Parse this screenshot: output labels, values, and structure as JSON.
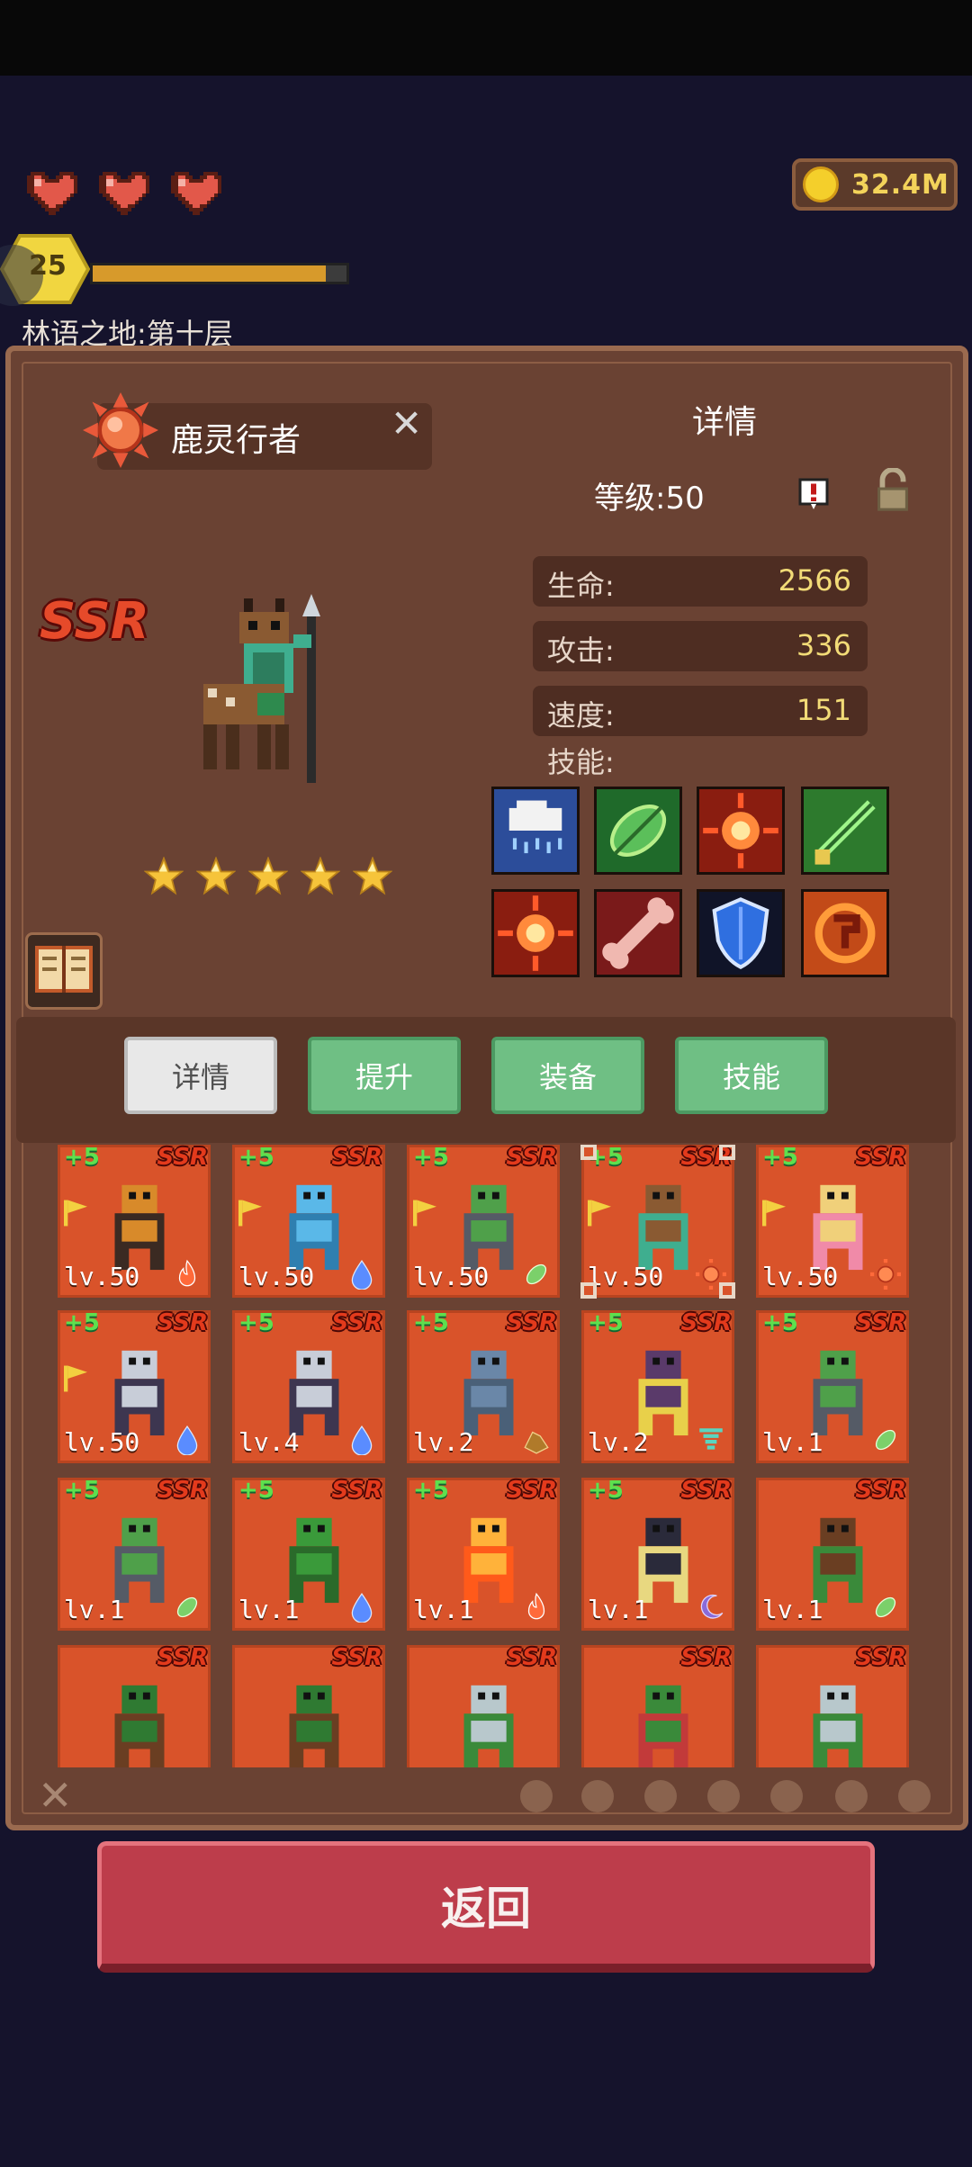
{
  "hud": {
    "gold": "32.4M",
    "player_level": "25",
    "xp_progress": 0.92,
    "location": "林语之地:第十层",
    "hearts": 3
  },
  "hero": {
    "name": "鹿灵行者",
    "rarity": "SSR",
    "stars": 5
  },
  "detail": {
    "title": "详情",
    "level_label": "等级:50",
    "stats": [
      {
        "label": "生命:",
        "value": "2566"
      },
      {
        "label": "攻击:",
        "value": "336"
      },
      {
        "label": "速度:",
        "value": "151"
      }
    ],
    "skills_label": "技能:",
    "skills": [
      {
        "icon": "rain-cloud-icon",
        "color": "#2c4d9a"
      },
      {
        "icon": "leaf-icon",
        "color": "#1f6a2a"
      },
      {
        "icon": "fire-burst-icon",
        "color": "#8a1d10"
      },
      {
        "icon": "green-sword-icon",
        "color": "#2d7a2d"
      },
      {
        "icon": "fire-burst-icon",
        "color": "#8a1d10"
      },
      {
        "icon": "bone-icon",
        "color": "#7a1a1a"
      },
      {
        "icon": "blue-shield-icon",
        "color": "#101428"
      },
      {
        "icon": "fire-circle-icon",
        "color": "#c24a18"
      }
    ]
  },
  "tabs": [
    {
      "label": "详情",
      "active": true
    },
    {
      "label": "提升",
      "active": false
    },
    {
      "label": "装备",
      "active": false
    },
    {
      "label": "技能",
      "active": false
    }
  ],
  "roster": [
    {
      "plus": "+5",
      "rarity": "SSR",
      "level": "lv.50",
      "flag": true,
      "element": "fire",
      "monster": "fire-warrior",
      "selected": false
    },
    {
      "plus": "+5",
      "rarity": "SSR",
      "level": "lv.50",
      "flag": true,
      "element": "water",
      "monster": "water-spirit",
      "selected": false
    },
    {
      "plus": "+5",
      "rarity": "SSR",
      "level": "lv.50",
      "flag": true,
      "element": "nature",
      "monster": "orc-rider",
      "selected": false
    },
    {
      "plus": "+5",
      "rarity": "SSR",
      "level": "lv.50",
      "flag": true,
      "element": "light",
      "monster": "deer-walker",
      "selected": true
    },
    {
      "plus": "+5",
      "rarity": "SSR",
      "level": "lv.50",
      "flag": true,
      "element": "light",
      "monster": "fairy",
      "selected": false
    },
    {
      "plus": "+5",
      "rarity": "SSR",
      "level": "lv.50",
      "flag": true,
      "element": "water",
      "monster": "ghost-knight",
      "selected": false
    },
    {
      "plus": "+5",
      "rarity": "SSR",
      "level": "lv.4",
      "flag": false,
      "element": "water",
      "monster": "ghost-knight",
      "selected": false
    },
    {
      "plus": "+5",
      "rarity": "SSR",
      "level": "lv.2",
      "flag": false,
      "element": "earth",
      "monster": "stone-golem",
      "selected": false
    },
    {
      "plus": "+5",
      "rarity": "SSR",
      "level": "lv.2",
      "flag": false,
      "element": "wind",
      "monster": "reaper",
      "selected": false
    },
    {
      "plus": "+5",
      "rarity": "SSR",
      "level": "lv.1",
      "flag": false,
      "element": "nature",
      "monster": "orc-rider",
      "selected": false
    },
    {
      "plus": "+5",
      "rarity": "SSR",
      "level": "lv.1",
      "flag": false,
      "element": "nature",
      "monster": "orc-rider",
      "selected": false
    },
    {
      "plus": "+5",
      "rarity": "SSR",
      "level": "lv.1",
      "flag": false,
      "element": "water",
      "monster": "swamp-ogre",
      "selected": false
    },
    {
      "plus": "+5",
      "rarity": "SSR",
      "level": "lv.1",
      "flag": false,
      "element": "fire",
      "monster": "flame-sprite",
      "selected": false
    },
    {
      "plus": "+5",
      "rarity": "SSR",
      "level": "lv.1",
      "flag": false,
      "element": "dark",
      "monster": "dark-knight",
      "selected": false
    },
    {
      "plus": "",
      "rarity": "SSR",
      "level": "lv.1",
      "flag": false,
      "element": "nature",
      "monster": "treant",
      "selected": false
    },
    {
      "plus": "",
      "rarity": "SSR",
      "level": "",
      "flag": false,
      "element": "",
      "monster": "tree-beast",
      "selected": false
    },
    {
      "plus": "",
      "rarity": "SSR",
      "level": "",
      "flag": false,
      "element": "",
      "monster": "tree-beast",
      "selected": false
    },
    {
      "plus": "",
      "rarity": "SSR",
      "level": "",
      "flag": false,
      "element": "",
      "monster": "wolf-warrior",
      "selected": false
    },
    {
      "plus": "",
      "rarity": "SSR",
      "level": "",
      "flag": false,
      "element": "",
      "monster": "orc-blade",
      "selected": false
    },
    {
      "plus": "",
      "rarity": "SSR",
      "level": "",
      "flag": false,
      "element": "",
      "monster": "wolf-warrior",
      "selected": false
    }
  ],
  "filters": [
    "fire",
    "earth",
    "water",
    "wind",
    "flame",
    "gear",
    "refresh"
  ],
  "back_label": "返回",
  "colors": {
    "background": "#15132c",
    "panel": "#6a4233",
    "card": "#d9532a",
    "tab_active": "#e8e8e8",
    "tab_normal": "#6fbf84",
    "back_button": "#bd3d4b",
    "gold_text": "#f3d35a"
  }
}
